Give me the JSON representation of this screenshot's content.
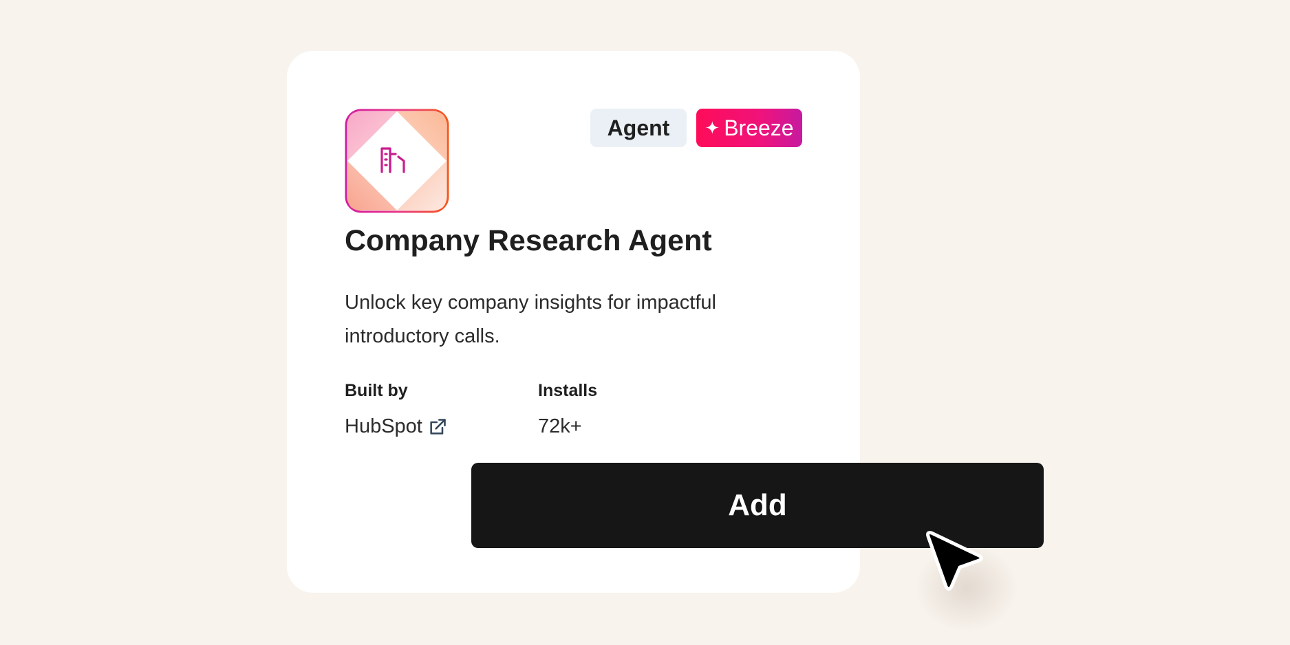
{
  "card": {
    "app_icon": "building-icon",
    "tags": {
      "agent": "Agent",
      "breeze": "Breeze",
      "breeze_icon": "sparkle-icon"
    },
    "title": "Company Research Agent",
    "description": "Unlock key company insights for impactful introductory calls.",
    "meta": {
      "built_by_label": "Built by",
      "built_by_value": "HubSpot",
      "built_by_icon": "external-link-icon",
      "installs_label": "Installs",
      "installs_value": "72k+"
    }
  },
  "add_button": {
    "label": "Add"
  },
  "cursor": "pointer-cursor-icon",
  "colors": {
    "background": "#f8f3ed",
    "card": "#ffffff",
    "button": "#161616",
    "breeze_start": "#fe0c59",
    "breeze_end": "#c61aa0",
    "agent_tag": "#eaf0f6",
    "icon_accent": "#c81e8c",
    "icon_border_start": "#d21c9c",
    "icon_border_end": "#f5581a"
  }
}
